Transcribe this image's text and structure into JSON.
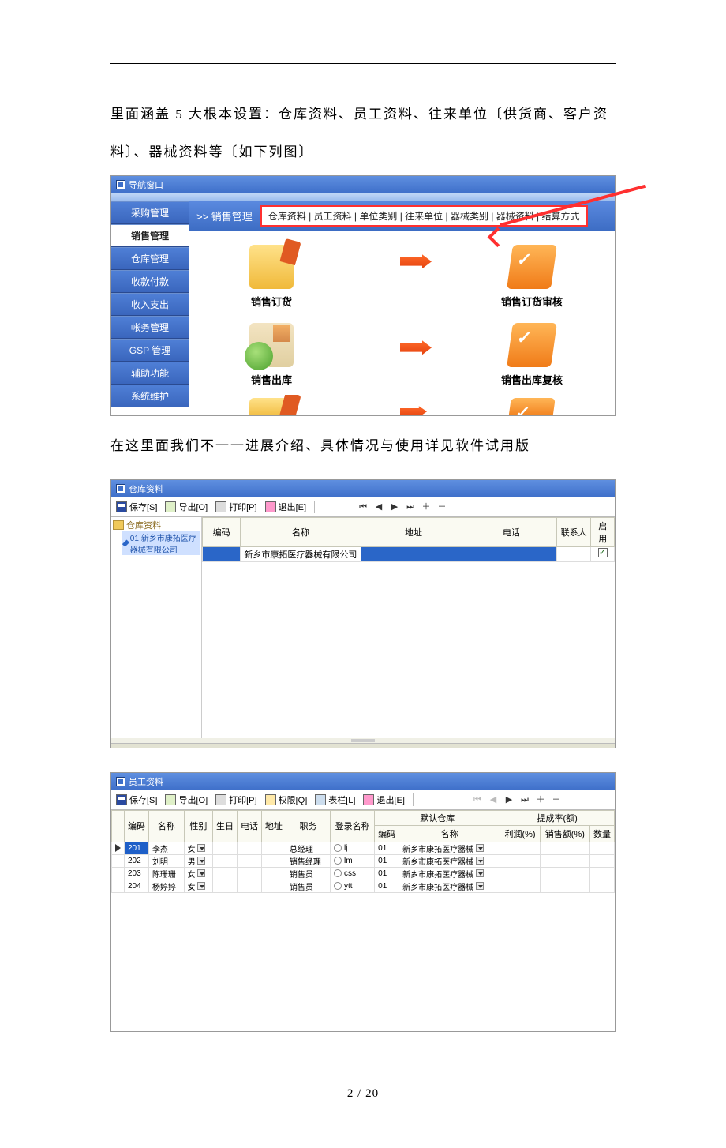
{
  "page": {
    "footer": "2  /  20"
  },
  "para1": "里面涵盖 5 大根本设置：仓库资料、员工资料、往来单位〔供货商、客户资料〕、器械资料等〔如下列图〕",
  "para2": "在这里面我们不一一进展介绍、具体情况与使用详见软件试用版",
  "shot1": {
    "title": "导航窗口",
    "crumb": ">> 销售管理",
    "tabstrip": "仓库资料 | 员工资料 | 单位类别 | 往来单位 | 器械类别 | 器械资料 | 结算方式",
    "sidebar": [
      "采购管理",
      "销售管理",
      "仓库管理",
      "收款付款",
      "收入支出",
      "帐务管理",
      "GSP 管理",
      "辅助功能",
      "系统维护"
    ],
    "cards": {
      "order": "销售订货",
      "audit": "销售订货审核",
      "out": "销售出库",
      "recheck": "销售出库复核"
    }
  },
  "shot2": {
    "title": "仓库资料",
    "toolbar": {
      "save": "保存[S]",
      "export": "导出[O]",
      "print": "打印[P]",
      "exit": "退出[E]"
    },
    "tree": {
      "root": "仓库资料",
      "child": "01 新乡市康拓医疗器械有限公司"
    },
    "cols": {
      "code": "编码",
      "name": "名称",
      "addr": "地址",
      "tel": "电话",
      "contact": "联系人",
      "enable": "启用"
    },
    "row": {
      "name": "新乡市康拓医疗器械有限公司"
    }
  },
  "shot3": {
    "title": "员工资料",
    "toolbar": {
      "save": "保存[S]",
      "export": "导出[O]",
      "print": "打印[P]",
      "perm": "权限[Q]",
      "cols": "表栏[L]",
      "exit": "退出[E]"
    },
    "cols": {
      "code": "编码",
      "name": "名称",
      "gender": "性别",
      "birth": "生日",
      "tel": "电话",
      "addr": "地址",
      "job": "职务",
      "login": "登录名称",
      "defwh_group": "默认仓库",
      "defwh_code": "编码",
      "defwh_name": "名称",
      "comm_group": "提成率(额)",
      "comm_profit": "利润(%)",
      "comm_sales": "销售额(%)",
      "comm_qty": "数量"
    },
    "rows": [
      {
        "code": "201",
        "name": "李杰",
        "gender": "女",
        "job": "总经理",
        "login": "lj",
        "wh_code": "01",
        "wh_name": "新乡市康拓医疗器械"
      },
      {
        "code": "202",
        "name": "刘明",
        "gender": "男",
        "job": "销售经理",
        "login": "lm",
        "wh_code": "01",
        "wh_name": "新乡市康拓医疗器械"
      },
      {
        "code": "203",
        "name": "陈珊珊",
        "gender": "女",
        "job": "销售员",
        "login": "css",
        "wh_code": "01",
        "wh_name": "新乡市康拓医疗器械"
      },
      {
        "code": "204",
        "name": "杨婷婷",
        "gender": "女",
        "job": "销售员",
        "login": "ytt",
        "wh_code": "01",
        "wh_name": "新乡市康拓医疗器械"
      }
    ]
  }
}
